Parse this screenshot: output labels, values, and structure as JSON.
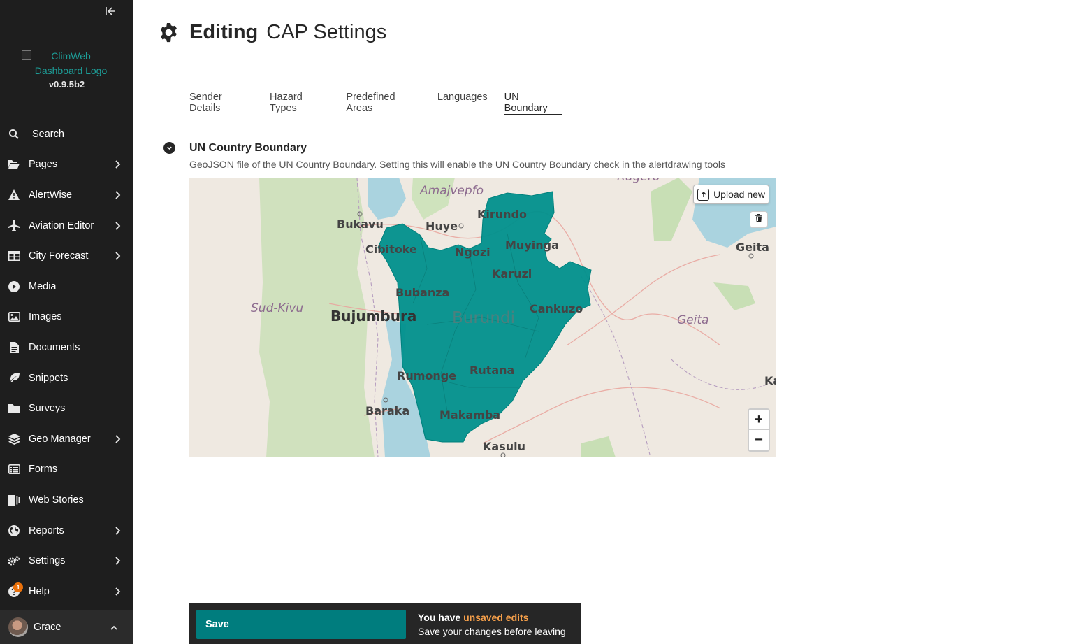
{
  "sidebar": {
    "collapse_icon": "collapse-left-icon",
    "logo_alt": "ClimWeb Dashboard Logo",
    "version": "v0.9.5b2",
    "search_label": "Search",
    "items": [
      {
        "label": "Pages",
        "icon": "folder-open-icon",
        "has_children": true
      },
      {
        "label": "AlertWise",
        "icon": "warning-icon",
        "has_children": true
      },
      {
        "label": "Aviation Editor",
        "icon": "plane-icon",
        "has_children": true
      },
      {
        "label": "City Forecast",
        "icon": "table-icon",
        "has_children": true
      },
      {
        "label": "Media",
        "icon": "play-icon",
        "has_children": false
      },
      {
        "label": "Images",
        "icon": "image-icon",
        "has_children": false
      },
      {
        "label": "Documents",
        "icon": "document-icon",
        "has_children": false
      },
      {
        "label": "Snippets",
        "icon": "leaf-icon",
        "has_children": false
      },
      {
        "label": "Surveys",
        "icon": "folder-icon",
        "has_children": false
      },
      {
        "label": "Geo Manager",
        "icon": "layers-icon",
        "has_children": true
      },
      {
        "label": "Forms",
        "icon": "list-icon",
        "has_children": false
      },
      {
        "label": "Web Stories",
        "icon": "stories-icon",
        "has_children": false
      },
      {
        "label": "Reports",
        "icon": "globe-icon",
        "has_children": true
      },
      {
        "label": "Settings",
        "icon": "cogs-icon",
        "has_children": true
      },
      {
        "label": "Help",
        "icon": "help-icon",
        "has_children": true,
        "badge": "1"
      }
    ],
    "user": {
      "name": "Grace"
    }
  },
  "header": {
    "editing": "Editing",
    "title": "CAP Settings"
  },
  "tabs": [
    {
      "label": "Sender Details",
      "active": false
    },
    {
      "label": "Hazard Types",
      "active": false
    },
    {
      "label": "Predefined Areas",
      "active": false
    },
    {
      "label": "Languages",
      "active": false
    },
    {
      "label": "UN Boundary",
      "active": true
    }
  ],
  "section": {
    "title": "UN Country Boundary",
    "help": "GeoJSON file of the UN Country Boundary. Setting this will enable the UN Country Boundary check in the alertdrawing tools"
  },
  "map": {
    "upload_label": "Upload new",
    "zoom_in": "+",
    "zoom_out": "−",
    "labels": {
      "amajvepfo": "Amajvepfo",
      "rugero": "Rugero",
      "kirundo": "Kirundo",
      "bukavu": "Bukavu",
      "huye": "Huye",
      "geita_city": "Geita",
      "cibitoke": "Cibitoke",
      "ngozi": "Ngozi",
      "muyinga": "Muyinga",
      "karuzi": "Karuzi",
      "bubanza": "Bubanza",
      "cankuzo": "Cankuzo",
      "sud_kivu": "Sud-Kivu",
      "bujumbura": "Bujumbura",
      "burundi": "Burundi",
      "geita_region": "Geita",
      "rumonge": "Rumonge",
      "rutana": "Rutana",
      "ka": "Ka",
      "baraka": "Baraka",
      "makamba": "Makamba",
      "kasulu": "Kasulu"
    },
    "colors": {
      "boundary_fill": "#00908c",
      "water": "#aad3df",
      "forest": "#c8dfb5",
      "land": "#efe9e1"
    }
  },
  "footer": {
    "save_label": "Save",
    "unsaved_prefix": "You have ",
    "unsaved_highlight": "unsaved edits",
    "unsaved_sub": "Save your changes before leaving"
  }
}
